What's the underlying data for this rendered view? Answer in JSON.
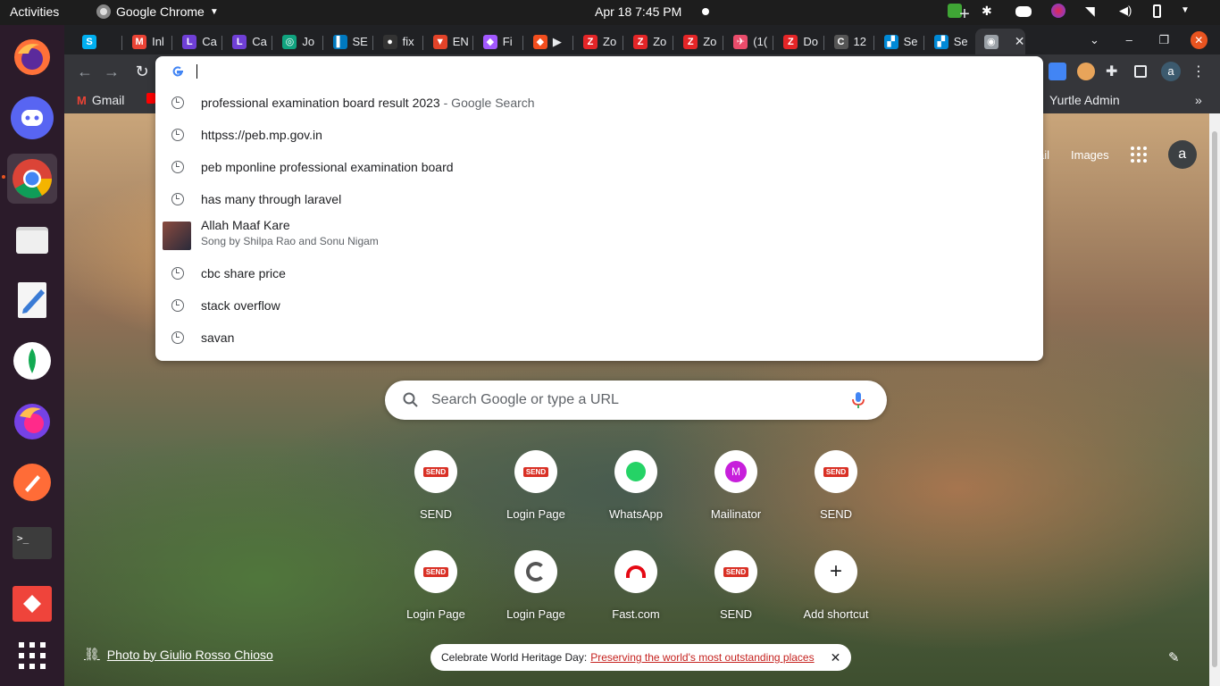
{
  "topbar": {
    "activities": "Activities",
    "app_name": "Google Chrome",
    "clock": "Apr 18  7:45 PM"
  },
  "dock": {
    "apps": [
      "firefox",
      "discord",
      "chrome",
      "files",
      "text-editor",
      "mongodb-compass",
      "firefox-developer",
      "postman",
      "terminal",
      "anydesk",
      "show-apps"
    ]
  },
  "tabs": [
    {
      "label": "",
      "icon": "skype-icon",
      "color": "#00aff0",
      "glyph": "S"
    },
    {
      "label": "Inl",
      "icon": "gmail-icon",
      "color": "#ea4335",
      "glyph": "M"
    },
    {
      "label": "Ca",
      "icon": "lt-icon",
      "color": "#6f3fd6",
      "glyph": "L"
    },
    {
      "label": "Ca",
      "icon": "lt-icon",
      "color": "#6f3fd6",
      "glyph": "L"
    },
    {
      "label": "Jo",
      "icon": "chatgpt-icon",
      "color": "#10a37f",
      "glyph": "◎"
    },
    {
      "label": "SE",
      "icon": "trello-icon",
      "color": "#0079bf",
      "glyph": "▌"
    },
    {
      "label": "fix",
      "icon": "github-icon",
      "color": "#333333",
      "glyph": "●"
    },
    {
      "label": "EN",
      "icon": "gitlab-icon",
      "color": "#e24329",
      "glyph": "▼"
    },
    {
      "label": "Fi",
      "icon": "figma-icon",
      "color": "#a259ff",
      "glyph": "◆"
    },
    {
      "label": "▶",
      "icon": "figma-icon",
      "color": "#f24e1e",
      "glyph": "◆"
    },
    {
      "label": "Zo",
      "icon": "zoho-icon",
      "color": "#e42527",
      "glyph": "Z"
    },
    {
      "label": "Zo",
      "icon": "zoho-icon",
      "color": "#e42527",
      "glyph": "Z"
    },
    {
      "label": "Zo",
      "icon": "zoho-icon",
      "color": "#e42527",
      "glyph": "Z"
    },
    {
      "label": "(1(",
      "icon": "clickup-icon",
      "color": "#e94c6b",
      "glyph": "✈"
    },
    {
      "label": "Do",
      "icon": "zoho-icon",
      "color": "#e42527",
      "glyph": "Z"
    },
    {
      "label": "12",
      "icon": "c-icon",
      "color": "#555555",
      "glyph": "C"
    },
    {
      "label": "Se",
      "icon": "azure-icon",
      "color": "#0089d6",
      "glyph": "▞"
    },
    {
      "label": "Se",
      "icon": "azure-icon",
      "color": "#0089d6",
      "glyph": "▞"
    },
    {
      "label": "",
      "icon": "chrome-icon",
      "color": "#9aa0a6",
      "glyph": "◉",
      "active": true
    }
  ],
  "bookmarks": {
    "gmail": "Gmail",
    "yurtle": "Yurtle Admin"
  },
  "omnibox": {
    "suggestions": [
      {
        "text": "professional examination board result 2023",
        "suffix": " - Google Search"
      },
      {
        "text": "httpss://peb.mp.gov.in",
        "suffix": ""
      },
      {
        "text": "peb mponline professional examination board",
        "suffix": ""
      },
      {
        "text": "has many through laravel",
        "suffix": ""
      }
    ],
    "song": {
      "title": "Allah Maaf Kare",
      "subtitle": "Song by Shilpa Rao and Sonu Nigam"
    },
    "more": [
      "cbc share price",
      "stack overflow",
      "savan"
    ]
  },
  "ntp": {
    "gmail_link": "ail",
    "images_link": "Images",
    "avatar_letter": "a",
    "search_placeholder": "Search Google or type a URL",
    "shortcuts_row1": [
      "SEND",
      "Login Page",
      "WhatsApp",
      "Mailinator",
      "SEND"
    ],
    "shortcuts_row2": [
      "Login Page",
      "Login Page",
      "Fast.com",
      "SEND",
      "Add shortcut"
    ],
    "send_badge": "SEND",
    "mailinator_letter": "M",
    "attribution": "Photo by Giulio Rosso Chioso",
    "promo_text": "Celebrate World Heritage Day: ",
    "promo_link": "Preserving the world's most outstanding places"
  },
  "profile_letter": "a"
}
